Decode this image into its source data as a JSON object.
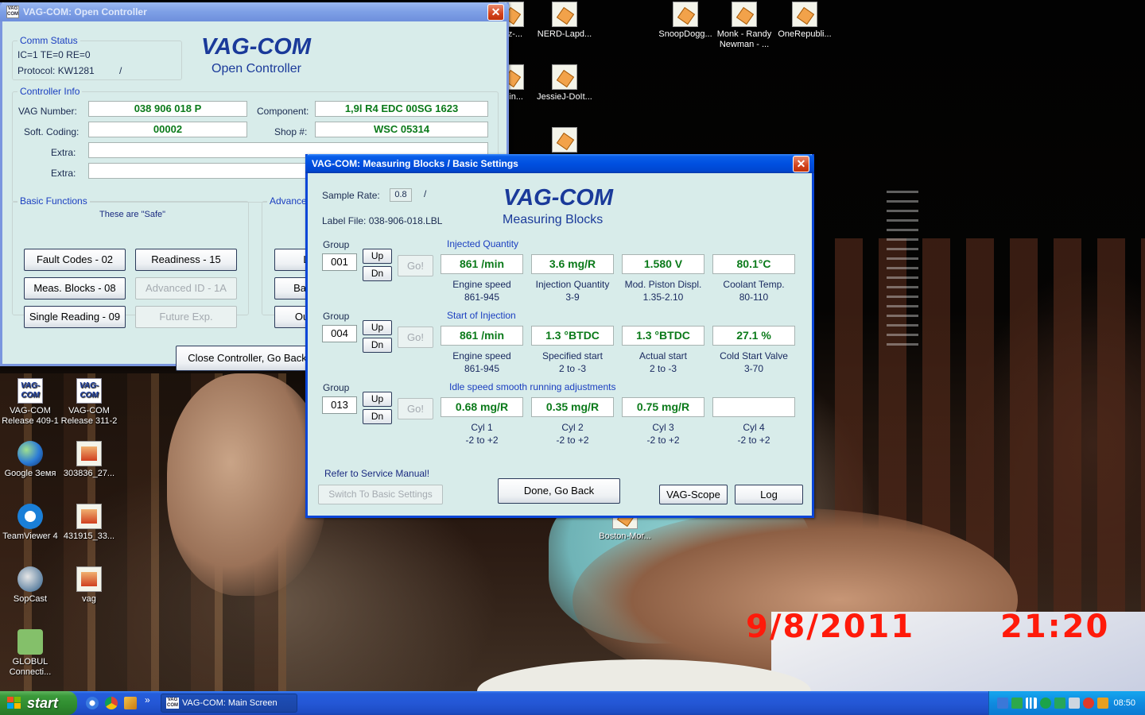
{
  "desktop": {
    "stamp_date": "9/8/2011",
    "stamp_time": "21:20",
    "icons": [
      {
        "label": "VAG-COM Release 409-1",
        "icon": "vag-com-icon"
      },
      {
        "label": "VAG-COM Release 311-2",
        "icon": "vag-com-icon"
      },
      {
        "label": "Google Земя",
        "icon": "google-earth-icon"
      },
      {
        "label": "303836_27...",
        "icon": "photo-file-icon"
      },
      {
        "label": "TeamViewer 4",
        "icon": "teamviewer-icon"
      },
      {
        "label": "431915_33...",
        "icon": "photo-file-icon"
      },
      {
        "label": "SopCast",
        "icon": "sopcast-icon"
      },
      {
        "label": "vag",
        "icon": "photo-file-icon"
      },
      {
        "label": "GLOBUL Connecti...",
        "icon": "globul-icon"
      },
      {
        "label": "raz-...",
        "icon": "audio-file-icon"
      },
      {
        "label": "NERD-Lapd...",
        "icon": "audio-file-icon"
      },
      {
        "label": "udin...",
        "icon": "audio-file-icon"
      },
      {
        "label": "JessieJ-DoIt...",
        "icon": "audio-file-icon"
      },
      {
        "label": "SnoopDogg...",
        "icon": "audio-file-icon"
      },
      {
        "label": "Monk - Randy Newman - ...",
        "icon": "audio-file-icon"
      },
      {
        "label": "OneRepubli...",
        "icon": "audio-file-icon"
      },
      {
        "label": "Boston-Mor...",
        "icon": "audio-file-icon"
      }
    ]
  },
  "open_controller": {
    "title": "VAG-COM: Open Controller",
    "brand": "VAG-COM",
    "brand_sub": "Open Controller",
    "comm_status": {
      "caption": "Comm Status",
      "line1": "IC=1  TE=0   RE=0",
      "protocol": "Protocol: KW1281",
      "indicator": "/"
    },
    "controller_info": {
      "caption": "Controller Info",
      "vag_number_label": "VAG Number:",
      "vag_number": "038 906 018 P",
      "component_label": "Component:",
      "component": "1,9l R4 EDC   00SG  1623",
      "soft_coding_label": "Soft. Coding:",
      "soft_coding": "00002",
      "shop_label": "Shop #:",
      "shop": "WSC 05314",
      "extra1_label": "Extra:",
      "extra1": "",
      "extra2_label": "Extra:",
      "extra2": ""
    },
    "basic_functions": {
      "caption": "Basic Functions",
      "note": "These are \"Safe\"",
      "fault_codes": "Fault Codes - 02",
      "readiness": "Readiness - 15",
      "meas_blocks": "Meas. Blocks - 08",
      "advanced_id": "Advanced ID - 1A",
      "single_reading": "Single Reading - 09",
      "future_exp": "Future Exp."
    },
    "advanced_caption": "Advance",
    "adv_btn1": "L",
    "adv_btn2": "Basic",
    "adv_btn3": "Outp",
    "close_button": "Close Controller, Go Back"
  },
  "measuring_blocks": {
    "title": "VAG-COM: Measuring Blocks / Basic Settings",
    "brand": "VAG-COM",
    "brand_sub": "Measuring Blocks",
    "sample_rate_label": "Sample Rate:",
    "sample_rate": "0.8",
    "sample_indicator": "/",
    "label_file": "Label File:  038-906-018.LBL",
    "group_label": "Group",
    "up_label": "Up",
    "dn_label": "Dn",
    "go_label": "Go!",
    "groups": [
      {
        "number": "001",
        "title": "Injected Quantity",
        "cells": [
          {
            "value": "861 /min",
            "name": "Engine speed",
            "range": "861-945"
          },
          {
            "value": "3.6 mg/R",
            "name": "Injection Quantity",
            "range": "3-9"
          },
          {
            "value": "1.580 V",
            "name": "Mod. Piston Displ.",
            "range": "1.35-2.10"
          },
          {
            "value": "80.1°C",
            "name": "Coolant Temp.",
            "range": "80-110"
          }
        ]
      },
      {
        "number": "004",
        "title": "Start of Injection",
        "cells": [
          {
            "value": "861 /min",
            "name": "Engine speed",
            "range": "861-945"
          },
          {
            "value": "1.3 °BTDC",
            "name": "Specified start",
            "range": "2 to -3"
          },
          {
            "value": "1.3 °BTDC",
            "name": "Actual start",
            "range": "2 to -3"
          },
          {
            "value": "27.1 %",
            "name": "Cold Start Valve",
            "range": "3-70"
          }
        ]
      },
      {
        "number": "013",
        "title": "Idle speed smooth running adjustments",
        "cells": [
          {
            "value": "0.68 mg/R",
            "name": "Cyl 1",
            "range": "-2 to +2"
          },
          {
            "value": "0.35 mg/R",
            "name": "Cyl 2",
            "range": "-2 to +2"
          },
          {
            "value": "0.75 mg/R",
            "name": "Cyl 3",
            "range": "-2 to +2"
          },
          {
            "value": "",
            "name": "Cyl 4",
            "range": "-2 to +2"
          }
        ]
      }
    ],
    "refer_note": "Refer to Service Manual!",
    "switch_button": "Switch To Basic Settings",
    "done_button": "Done, Go Back",
    "scope_button": "VAG-Scope",
    "log_button": "Log"
  },
  "taskbar": {
    "start_label": "start",
    "task_item": "VAG-COM: Main Screen",
    "overflow": "»",
    "clock": "08:50"
  }
}
